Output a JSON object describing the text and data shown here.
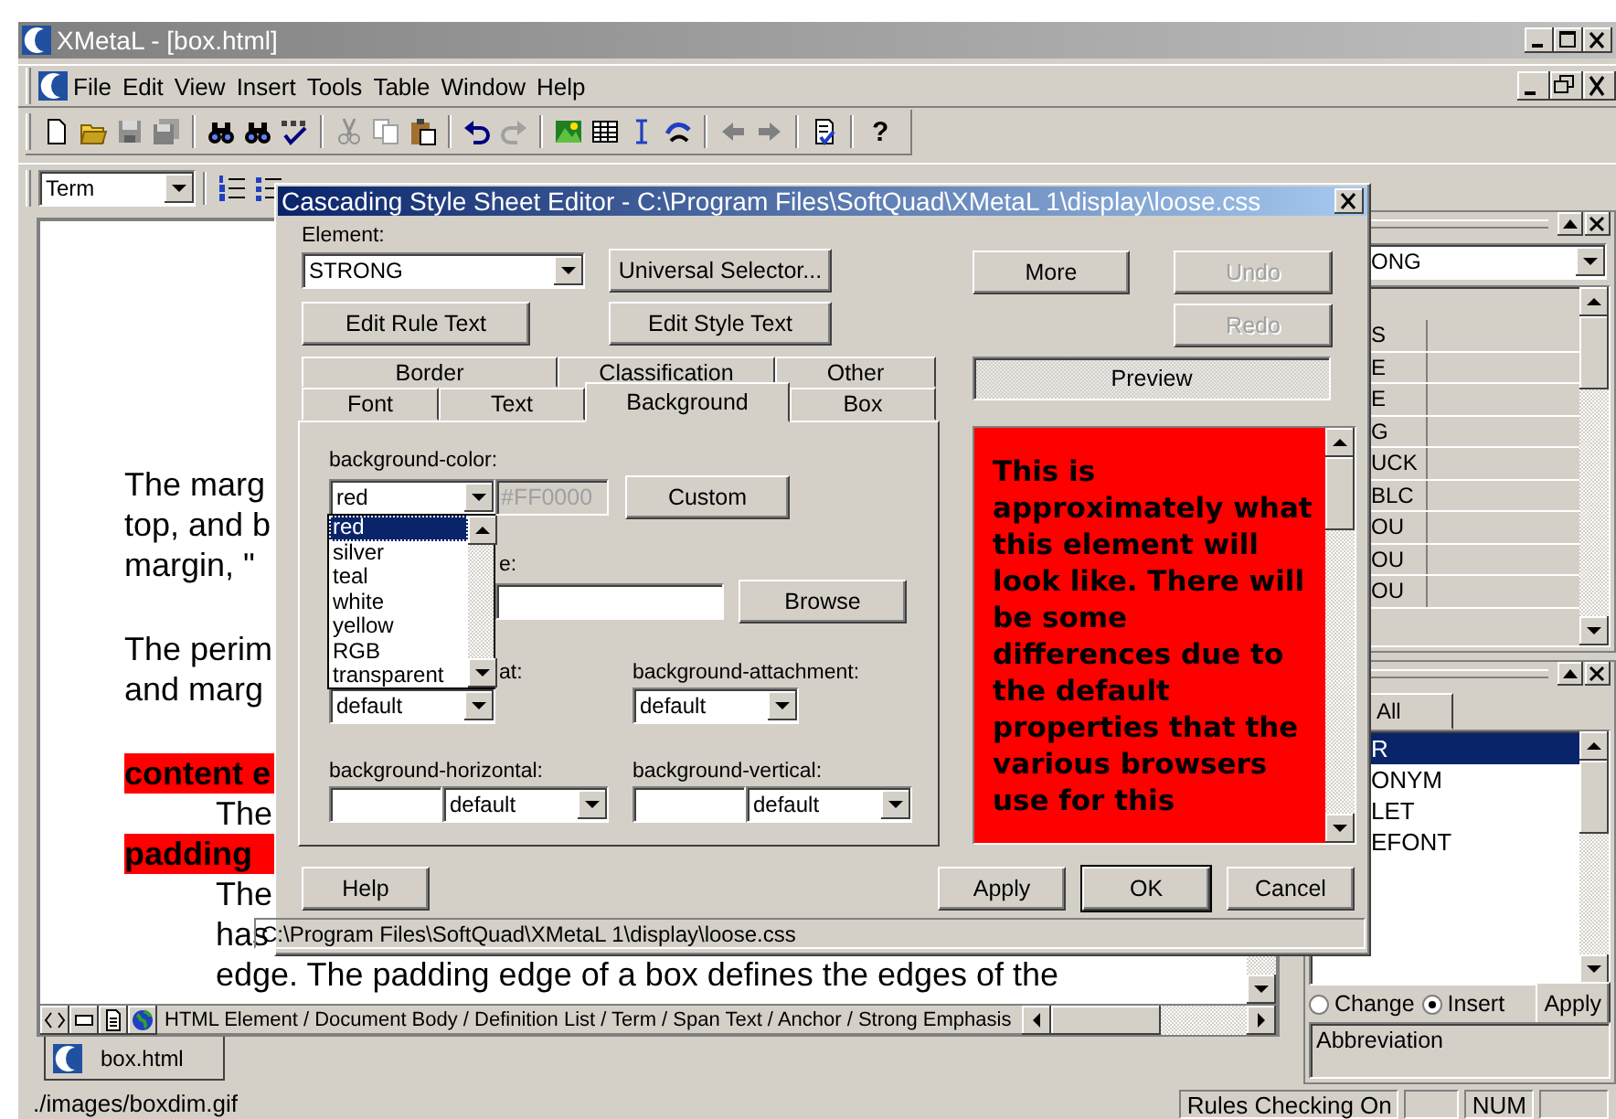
{
  "window": {
    "title": "XMetaL - [box.html]"
  },
  "menu": [
    "File",
    "Edit",
    "View",
    "Insert",
    "Tools",
    "Table",
    "Window",
    "Help"
  ],
  "toolbar": {
    "help": "?"
  },
  "format_bar": {
    "style": "Term"
  },
  "document": {
    "blocks": [
      {
        "kind": "text",
        "lines": [
          "The marg",
          "top, and b",
          "margin, \""
        ]
      },
      {
        "kind": "text",
        "lines": [
          "The perim",
          "and marg"
        ]
      },
      {
        "kind": "term",
        "lines": [
          "content e"
        ]
      },
      {
        "kind": "definition",
        "lines": [
          "The"
        ]
      },
      {
        "kind": "term",
        "lines": [
          "padding"
        ]
      },
      {
        "kind": "definition",
        "lines": [
          "The",
          "has",
          "edge. The padding edge of a box defines the edges of the"
        ]
      }
    ],
    "breadcrumb": "HTML Element / Document Body / Definition List / Term / Span Text / Anchor / Strong Emphasis",
    "tabs": [
      {
        "label": "box.html",
        "selected": true
      }
    ]
  },
  "elements_panel": {
    "value": "ONG",
    "rows": [
      "S",
      "E",
      "E",
      "G",
      "UCK",
      "BLC",
      "OU",
      "OU",
      "OU"
    ]
  },
  "insert_panel": {
    "tab": "All",
    "items": [
      {
        "text": "R",
        "selected": true
      },
      {
        "text": "ONYM",
        "selected": false
      },
      {
        "text": "LET",
        "selected": false
      },
      {
        "text": "EFONT",
        "selected": false
      }
    ],
    "modes": [
      {
        "label": "Change",
        "selected": false
      },
      {
        "label": "Insert",
        "selected": true
      }
    ],
    "apply": "Apply",
    "description": "Abbreviation"
  },
  "dialog": {
    "title": "Cascading Style Sheet Editor - C:\\Program Files\\SoftQuad\\XMetaL 1\\display\\loose.css",
    "element_label": "Element:",
    "element": "STRONG",
    "universal": {
      "label": "Universal Selector...",
      "disabled": false
    },
    "edit_rule": {
      "label": "Edit Rule Text",
      "disabled": false
    },
    "edit_style": {
      "label": "Edit Style Text",
      "disabled": false
    },
    "more": {
      "label": "More",
      "disabled": false
    },
    "undo": {
      "label": "Undo",
      "disabled": true
    },
    "redo": {
      "label": "Redo",
      "disabled": true
    },
    "preview": {
      "label": "Preview",
      "on": true
    },
    "tab_rows": [
      [
        {
          "label": "Border",
          "selected": false
        },
        {
          "label": "Classification",
          "selected": false
        },
        {
          "label": "Other",
          "selected": false
        }
      ],
      [
        {
          "label": "Font",
          "selected": false
        },
        {
          "label": "Text",
          "selected": false
        },
        {
          "label": "Background",
          "selected": true
        },
        {
          "label": "Box",
          "selected": false
        }
      ]
    ],
    "color": {
      "label": "background-color:",
      "value": "red",
      "hex": "#FF0000",
      "button": "Custom"
    },
    "color_options": [
      {
        "label": "red",
        "selected": true
      },
      {
        "label": "silver",
        "selected": false
      },
      {
        "label": "teal",
        "selected": false
      },
      {
        "label": "white",
        "selected": false
      },
      {
        "label": "yellow",
        "selected": false
      },
      {
        "label": "RGB",
        "selected": false
      },
      {
        "label": "transparent",
        "selected": false
      }
    ],
    "image": {
      "label": "e:",
      "button": "Browse"
    },
    "repeat": {
      "label": "at:",
      "value": "default"
    },
    "attachment": {
      "label": "background-attachment:",
      "value": "default"
    },
    "horizontal": {
      "label": "background-horizontal:",
      "value": "default"
    },
    "vertical": {
      "label": "background-vertical:",
      "value": "default"
    },
    "preview_text": "This is approximately what this element will look like. There will be some differences due to the default properties that the various browsers use for this",
    "buttons": [
      {
        "label": "Help",
        "kind": "left"
      },
      {
        "label": "Apply",
        "kind": "normal"
      },
      {
        "label": "OK",
        "kind": "default"
      },
      {
        "label": "Cancel",
        "kind": "normal"
      }
    ],
    "status": "C:\\Program Files\\SoftQuad\\XMetaL 1\\display\\loose.css"
  },
  "status_bar": {
    "message": "./images/boxdim.gif",
    "cells": [
      "Rules Checking On",
      "NUM"
    ]
  }
}
